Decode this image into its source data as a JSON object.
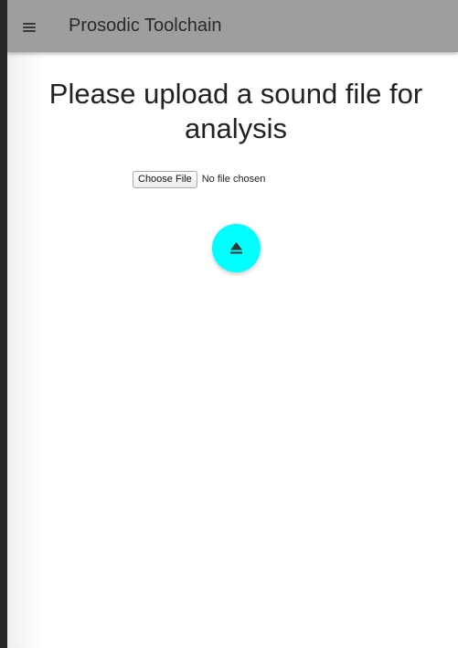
{
  "toolbar": {
    "menu_icon": "hamburger-menu-icon",
    "title": "Prosodic Toolchain",
    "background": "#9e9e9e"
  },
  "main": {
    "heading": "Please upload a sound file for analysis",
    "file_input": {
      "button_label": "Choose File",
      "status": "No file chosen"
    },
    "upload_button": {
      "icon": "eject-icon",
      "color": "#00ffff"
    }
  }
}
